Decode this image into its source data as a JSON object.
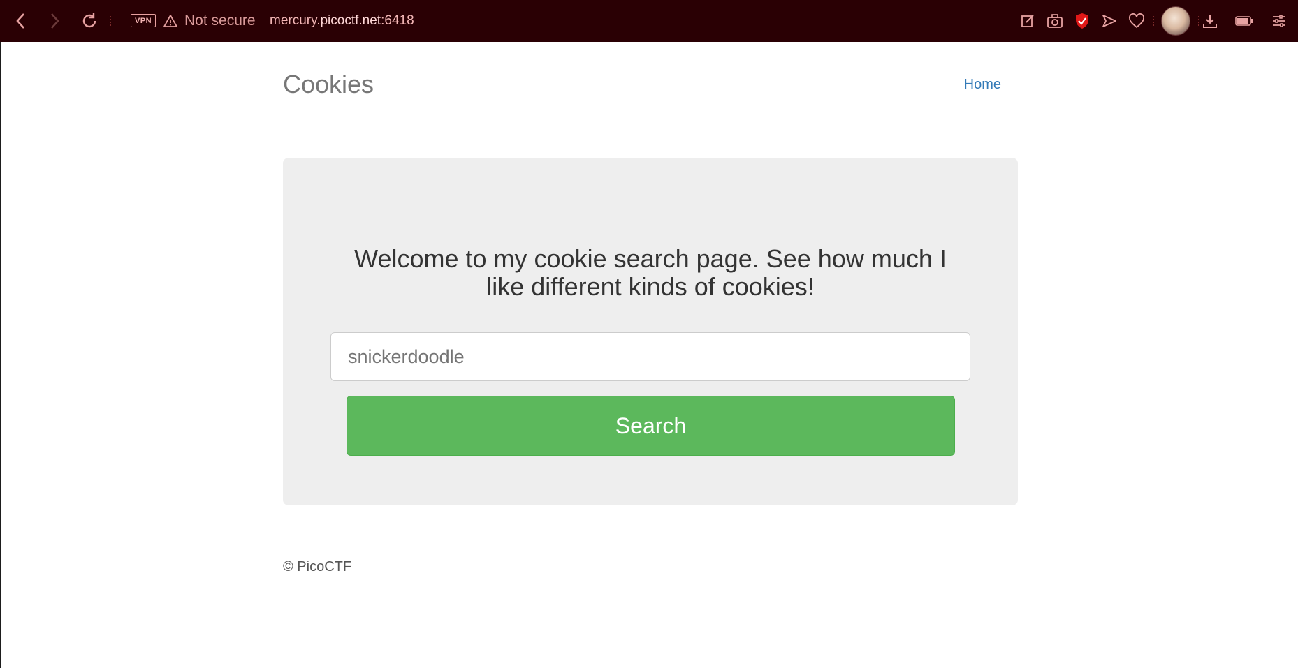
{
  "browser": {
    "vpn_label": "VPN",
    "security_text": "Not secure",
    "url_prefix": "mercury.",
    "url_host": "picoctf.net",
    "url_port": ":6418",
    "accent_color": "#2a0004"
  },
  "page": {
    "brand": "Cookies",
    "nav_home": "Home",
    "welcome_text": "Welcome to my cookie search page. See how much I like different kinds of cookies!",
    "search_placeholder": "snickerdoodle",
    "search_button": "Search",
    "footer_text": "© PicoCTF",
    "button_color": "#5cb85c",
    "link_color": "#337ab7"
  }
}
